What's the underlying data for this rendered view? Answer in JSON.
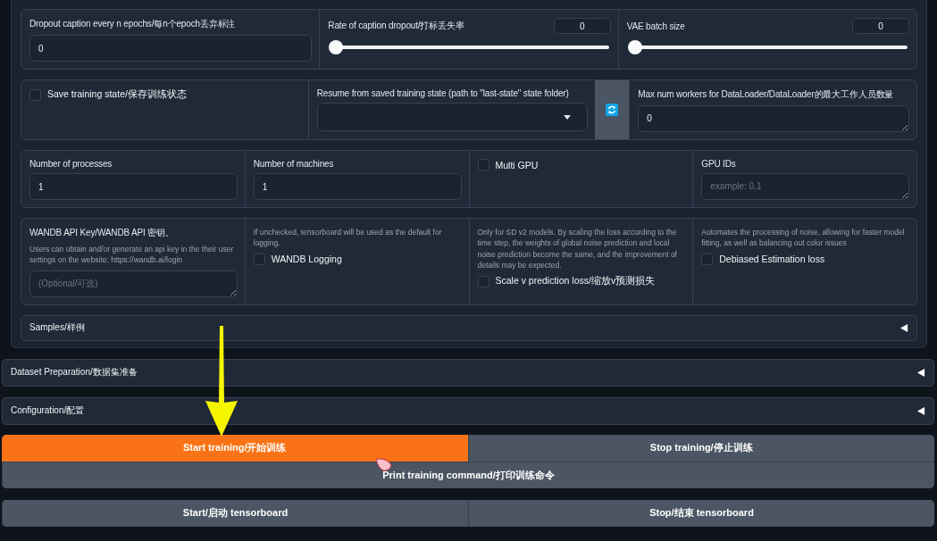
{
  "panel_rows": [
    {
      "cells": [
        {
          "kind": "number",
          "label": "Dropout caption every n epochs/每n个epoch丢弃标注",
          "value": "0"
        },
        {
          "kind": "slider",
          "label": "Rate of caption dropout/打标丢失率",
          "value": "0",
          "level": 0
        },
        {
          "kind": "slider",
          "label": "VAE batch size",
          "value": "0",
          "level": 0
        }
      ]
    },
    {
      "cells": [
        {
          "kind": "checkbox",
          "label": "Save training state/保存训练状态",
          "checked": false
        },
        {
          "kind": "dropdown",
          "label": "Resume from saved training state (path to \"last-state\" state folder)"
        },
        {
          "kind": "refresh"
        },
        {
          "kind": "textarea",
          "label": "Max num workers for DataLoader/DataLoader的最大工作人员数量",
          "value": "0"
        }
      ]
    },
    {
      "cells": [
        {
          "kind": "number",
          "label": "Number of processes",
          "value": "1"
        },
        {
          "kind": "number",
          "label": "Number of machines",
          "value": "1"
        },
        {
          "kind": "checkbox",
          "label": "Multi GPU",
          "checked": false
        },
        {
          "kind": "textarea",
          "label": "GPU IDs",
          "placeholder": "example: 0,1"
        }
      ]
    },
    {
      "cells": [
        {
          "kind": "textarea",
          "label": "WANDB API Key/WANDB API 密钥。",
          "description": "Users can obtain and/or generate an api key in the their user settings on the website: https://wandb.ai/login",
          "placeholder": "(Optional/可选)"
        },
        {
          "kind": "checkbox",
          "description": "If unchecked, tensorboard will be used as the default for logging.",
          "label": "WANDB Logging",
          "checked": false
        },
        {
          "kind": "checkbox",
          "description": "Only for SD v2 models. By scaling the loss according to the time step, the weights of global noise prediction and local noise prediction become the same, and the improvement of details may be expected.",
          "label": "Scale v prediction loss/缩放v预测损失",
          "checked": false
        },
        {
          "kind": "checkbox",
          "description": "Automates the processing of noise, allowing for faster model fitting, as well as balancing out color issues",
          "label": "Debiased Estimation loss",
          "checked": false
        }
      ]
    }
  ],
  "panel_accordions": [
    {
      "label": "Samples/样例",
      "expanded": false
    }
  ],
  "accordions": [
    {
      "label": "Dataset Preparation/数据集准备",
      "expanded": false
    },
    {
      "label": "Configuration/配置",
      "expanded": false
    }
  ],
  "button_rows": [
    [
      {
        "label": "Start training/开始训练"
      },
      {
        "label": "Stop training/停止训练"
      }
    ],
    [
      {
        "label": "Print training command/打印训练命令"
      }
    ]
  ],
  "tensorboard_buttons": [
    {
      "label": "Start/启动 tensorboard"
    },
    {
      "label": "Stop/结束 tensorboard"
    }
  ]
}
